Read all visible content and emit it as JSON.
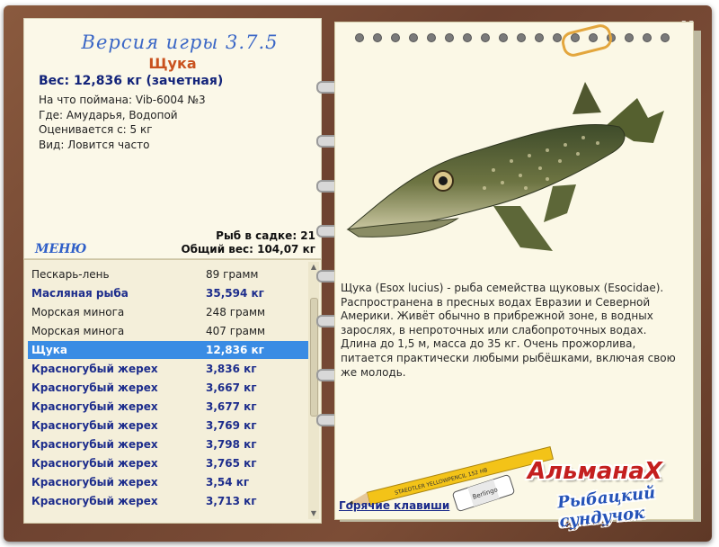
{
  "window": {
    "close_glyph": "x"
  },
  "header": {
    "version": "Версия игры 3.7.5",
    "fish_name": "Щука",
    "weight_line": "Вес: 12,836 кг (зачетная)",
    "info": [
      "На что поймана: Vib-6004 №3",
      "Где: Амударья, Водопой",
      "Оценивается с: 5 кг",
      "Вид: Ловится часто"
    ],
    "cage_count": "Рыб в садке: 21",
    "cage_total": "Общий вес: 104,07 кг",
    "menu_label": "МЕНЮ"
  },
  "catch_list": [
    {
      "name": "Пескарь-лень",
      "weight": "89 грамм",
      "style": "reg"
    },
    {
      "name": "Масляная рыба",
      "weight": "35,594 кг",
      "style": "bold"
    },
    {
      "name": "Морская минога",
      "weight": "248 грамм",
      "style": "reg"
    },
    {
      "name": "Морская минога",
      "weight": "407 грамм",
      "style": "reg"
    },
    {
      "name": "Щука",
      "weight": "12,836 кг",
      "style": "sel"
    },
    {
      "name": "Красногубый жерех",
      "weight": "3,836 кг",
      "style": "bold"
    },
    {
      "name": "Красногубый жерех",
      "weight": "3,667 кг",
      "style": "bold"
    },
    {
      "name": "Красногубый жерех",
      "weight": "3,677 кг",
      "style": "bold"
    },
    {
      "name": "Красногубый жерех",
      "weight": "3,769 кг",
      "style": "bold"
    },
    {
      "name": "Красногубый жерех",
      "weight": "3,798 кг",
      "style": "bold"
    },
    {
      "name": "Красногубый жерех",
      "weight": "3,765 кг",
      "style": "bold"
    },
    {
      "name": "Красногубый жерех",
      "weight": "3,54 кг",
      "style": "bold"
    },
    {
      "name": "Красногубый жерех",
      "weight": "3,713 кг",
      "style": "bold"
    }
  ],
  "description": "Щука (Esox lucius) - рыба семейства щуковых (Esocidae). Распространена в пресных водах Евразии и Северной Америки. Живёт обычно в прибрежной зоне, в водных зарослях, в непроточных или слабопроточных водах. Длина до 1,5 м, масса до 35 кг. Очень прожорлива, питается практически любыми рыбёшками, включая свою же молодь.",
  "footer": {
    "hotkeys_label": "Горячие клавиши",
    "logo_line1": "АльманаХ",
    "logo_line2": "Рыбацкий сундучок",
    "pencil_text": "STAEDTLER YELLOWPENCIL 152 HB",
    "eraser_text": "Berlingo"
  },
  "colors": {
    "frame": "#6d4230",
    "paper": "#fbf8e6",
    "selection": "#3a8ce4",
    "version_blue": "#3b67c6",
    "fish_title": "#c9521e",
    "bold_row": "#1d2d8c"
  }
}
